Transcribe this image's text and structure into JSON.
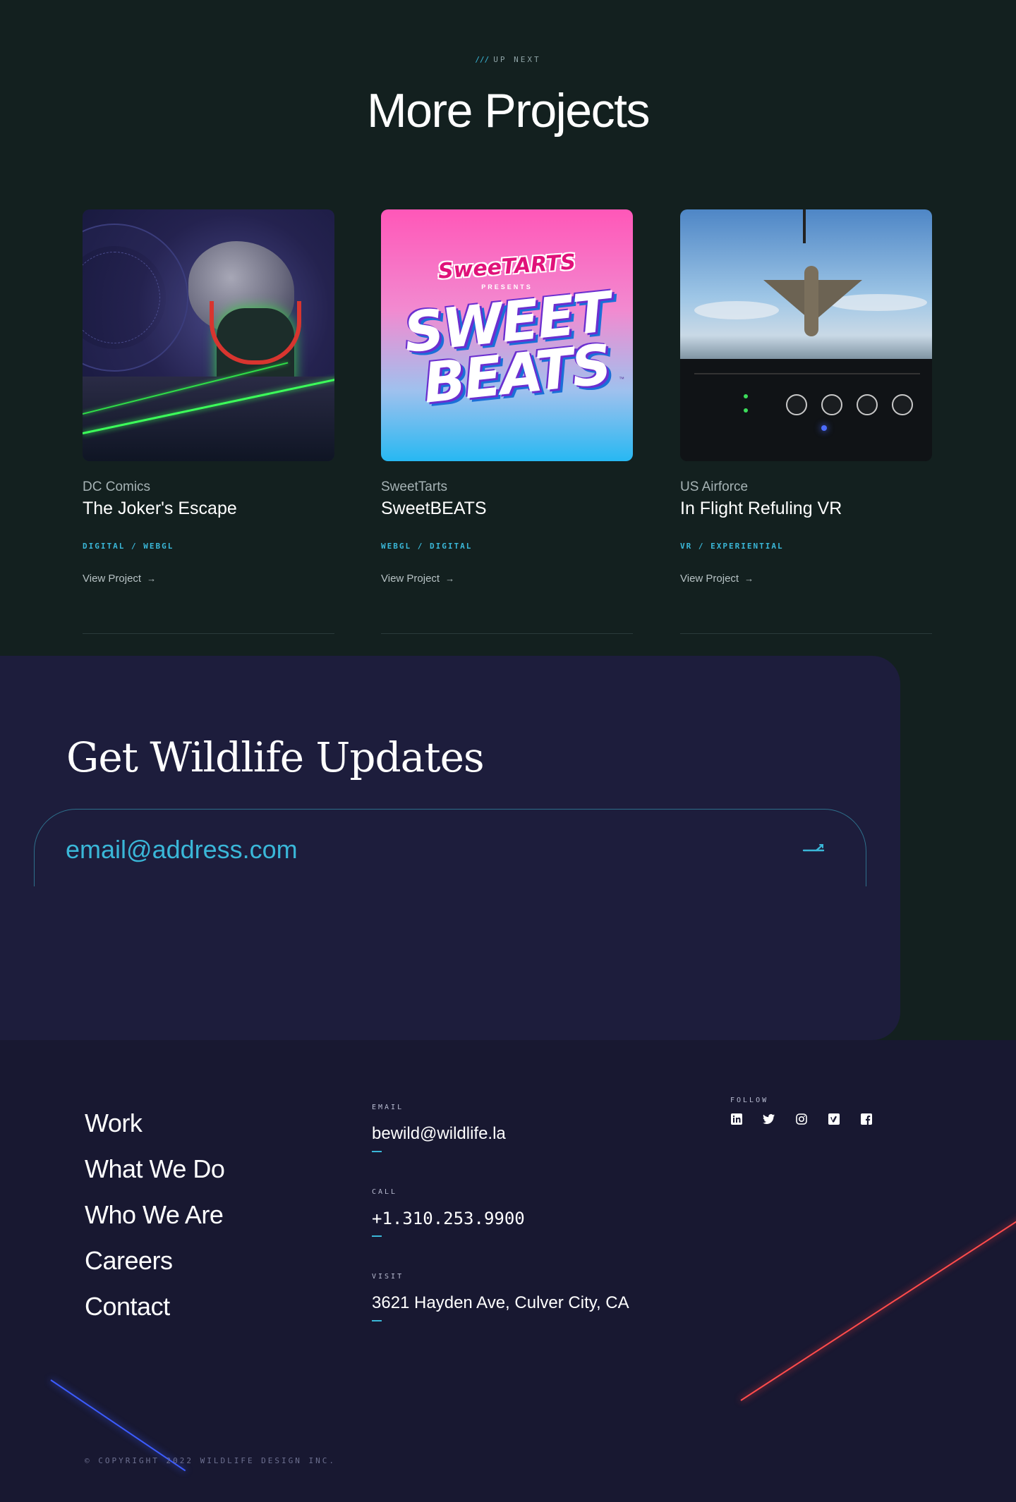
{
  "up_next": {
    "slashes": "///",
    "label": "UP NEXT"
  },
  "section_title": "More Projects",
  "projects": [
    {
      "client": "DC Comics",
      "title": "The Joker's Escape",
      "tags": "DIGITAL / WEBGL",
      "link": "View Project"
    },
    {
      "client": "SweetTarts",
      "title": "SweetBEATS",
      "tags": "WEBGL / DIGITAL",
      "link": "View Project"
    },
    {
      "client": "US Airforce",
      "title": "In Flight Refuling VR",
      "tags": "VR / EXPERIENTIAL",
      "link": "View Project"
    }
  ],
  "sweet_art": {
    "brand": "SweeTARTS",
    "presents": "PRESENTS",
    "line1": "SWEET",
    "line2": "BEATS",
    "tm": "™"
  },
  "newsletter": {
    "title": "Get Wildlife Updates",
    "email_placeholder": "email@address.com",
    "submit_icon": "arrow-submit-icon"
  },
  "footer": {
    "nav": [
      "Work",
      "What We Do",
      "Who We Are",
      "Careers",
      "Contact"
    ],
    "email": {
      "label": "EMAIL",
      "value": "bewild@wildlife.la"
    },
    "call": {
      "label": "CALL",
      "value": "+1.310.253.9900"
    },
    "visit": {
      "label": "VISIT",
      "value": "3621 Hayden Ave, Culver City, CA"
    },
    "follow": {
      "label": "FOLLOW",
      "icons": [
        "linkedin-icon",
        "twitter-icon",
        "instagram-icon",
        "vimeo-icon",
        "facebook-icon"
      ]
    },
    "copyright": "© COPYRIGHT 2022 WILDLIFE DESIGN INC."
  },
  "colors": {
    "accent": "#3ab7d8",
    "background": "#13201f",
    "newsletter_bg": "#1d1d3c",
    "footer_bg": "#181831"
  }
}
